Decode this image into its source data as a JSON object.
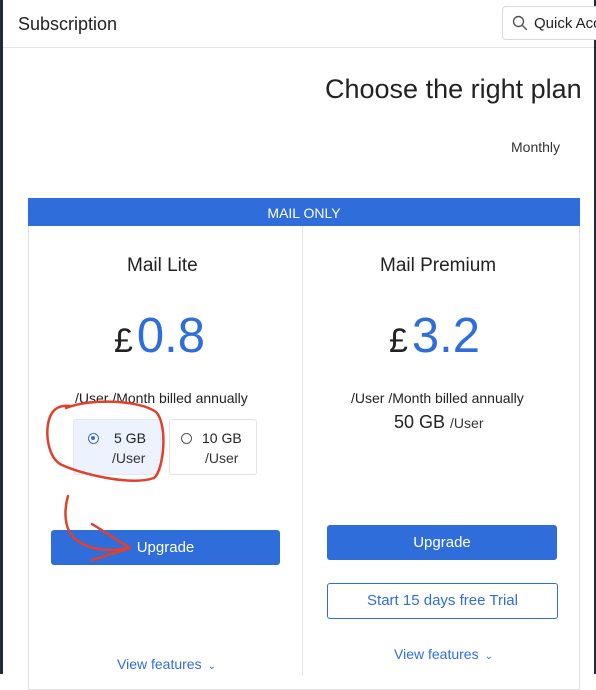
{
  "header": {
    "app_title": "Subscription",
    "quick_access_label": "Quick Acc"
  },
  "main": {
    "heading": "Choose the right plan",
    "billing_cycle": "Monthly",
    "category_banner": "MAIL ONLY",
    "plans": [
      {
        "name": "Mail Lite",
        "currency": "£",
        "price": "0.8",
        "billing_note": "/User /Month billed annually",
        "storage_options": [
          {
            "size": "5 GB",
            "unit": "/User",
            "selected": true
          },
          {
            "size": "10 GB",
            "unit": "/User",
            "selected": false
          }
        ],
        "upgrade_label": "Upgrade",
        "view_features_label": "View features"
      },
      {
        "name": "Mail Premium",
        "currency": "£",
        "price": "3.2",
        "billing_note": "/User /Month billed annually",
        "storage": {
          "size": "50 GB",
          "unit": "/User"
        },
        "upgrade_label": "Upgrade",
        "trial_label": "Start 15 days free Trial",
        "view_features_label": "View features"
      }
    ]
  },
  "colors": {
    "accent": "#2f6ddb",
    "annotation": "#e0412d",
    "selected_option_bg": "#edf3fe"
  },
  "icons": {
    "quick_access": "search-icon",
    "view_features": "chevron-down-icon",
    "selected_radio": "radio-checked-icon"
  }
}
